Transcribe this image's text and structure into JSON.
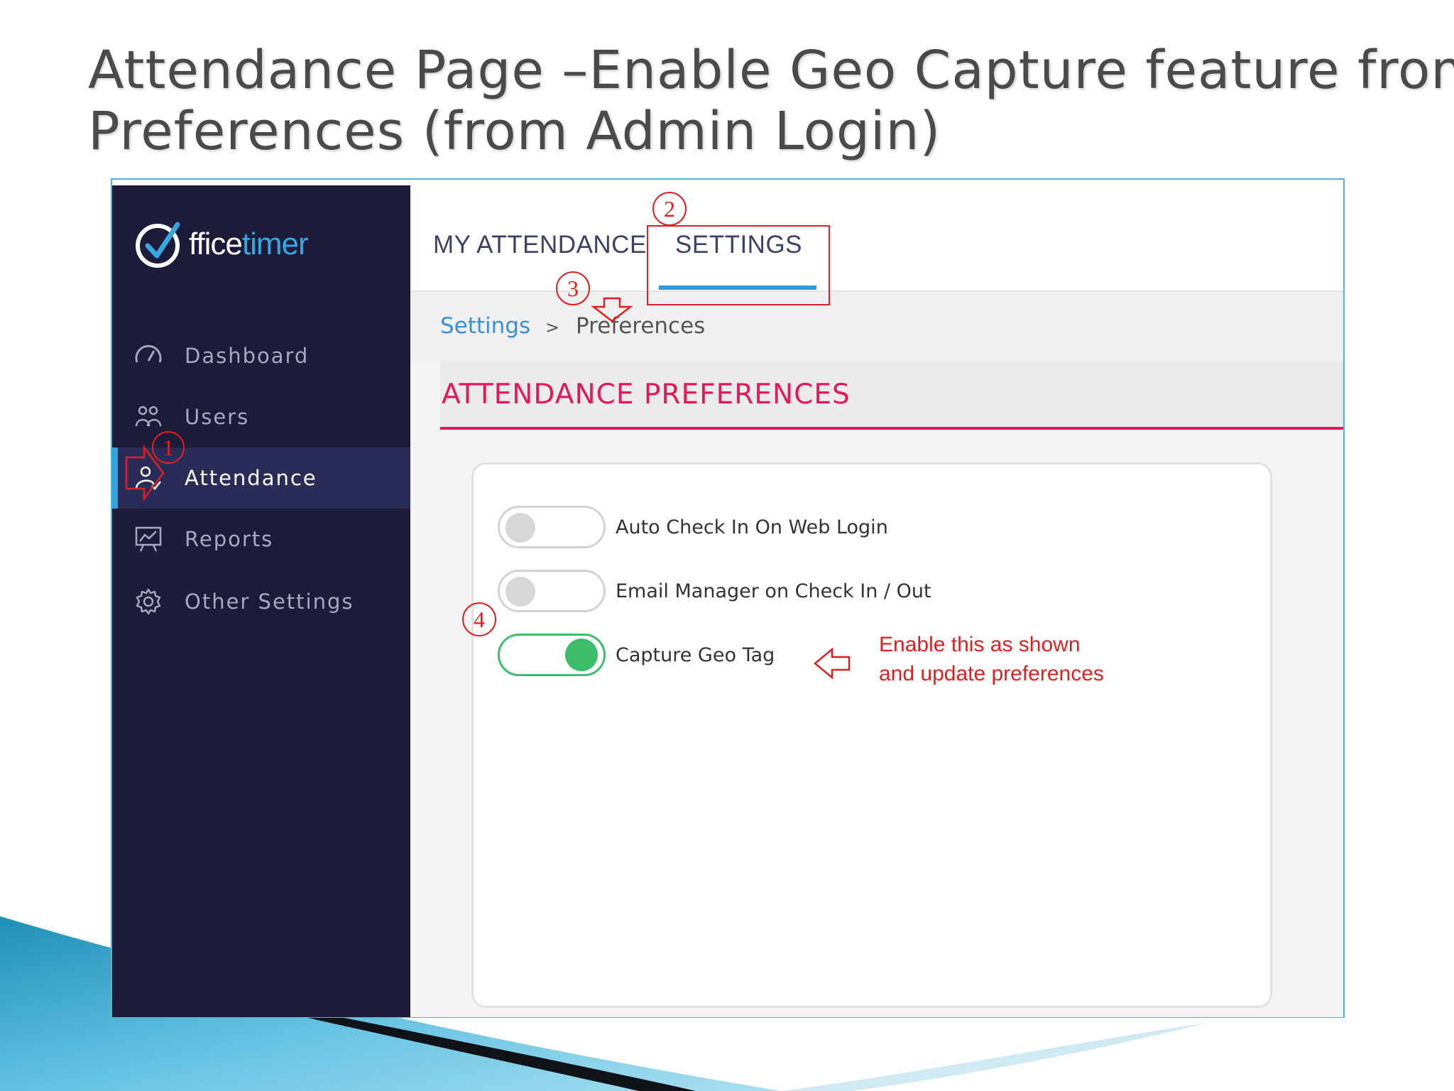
{
  "slide": {
    "title_line1": "Attendance Page –Enable Geo Capture feature from",
    "title_line2": "Preferences (from Admin Login)"
  },
  "app": {
    "logo": {
      "text_prefix": "ffice",
      "text_accent": "timer",
      "icon": "officetimer-check-o-icon"
    },
    "sidebar": {
      "items": [
        {
          "label": "Dashboard",
          "icon": "speedometer-icon",
          "active": false
        },
        {
          "label": "Users",
          "icon": "users-icon",
          "active": false
        },
        {
          "label": "Attendance",
          "icon": "user-check-icon",
          "active": true
        },
        {
          "label": "Reports",
          "icon": "presentation-chart-icon",
          "active": false
        },
        {
          "label": "Other Settings",
          "icon": "gear-icon",
          "active": false
        }
      ]
    },
    "tabs": [
      {
        "label": "MY ATTENDANCE",
        "active": false
      },
      {
        "label": "SETTINGS",
        "active": true
      }
    ],
    "breadcrumb": {
      "link": "Settings",
      "separator": ">",
      "current": "Preferences"
    },
    "section_title": "ATTENDANCE PREFERENCES",
    "preferences": [
      {
        "label": "Auto Check In On Web Login",
        "enabled": false
      },
      {
        "label": "Email Manager on Check In / Out",
        "enabled": false
      },
      {
        "label": "Capture Geo Tag",
        "enabled": true
      }
    ]
  },
  "annotations": {
    "step_numbers": [
      "1",
      "2",
      "3",
      "4"
    ],
    "note_line1": "Enable this as shown",
    "note_line2": "and update preferences",
    "color": "#e02020"
  },
  "colors": {
    "sidebar_bg": "#1c1b3a",
    "accent_blue": "#2b9ce0",
    "section_pink": "#e0195a",
    "toggle_on": "#3ebd6d"
  }
}
